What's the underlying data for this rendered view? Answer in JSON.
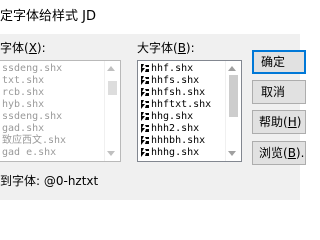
{
  "window": {
    "title": "定字体给样式 JD"
  },
  "small_font": {
    "label_prefix": "字体(",
    "label_key": "X",
    "label_suffix": "):",
    "items": [
      "ssdeng.shx",
      "txt.shx",
      "rcb.shx",
      "hyb.shx",
      "ssdeng.shx",
      "gad.shx",
      "致应西文.shx",
      "gad e.shx"
    ]
  },
  "big_font": {
    "label_prefix": "大字体(",
    "label_key": "B",
    "label_suffix": "):",
    "items": [
      "hhf.shx",
      "hhfs.shx",
      "hhfsh.shx",
      "hhftxt.shx",
      "hhg.shx",
      "hhh2.shx",
      "hhhbh.shx",
      "hhhg.shx"
    ]
  },
  "buttons": {
    "ok_label": "确定",
    "cancel_label": "取消",
    "help_prefix": "帮助(",
    "help_key": "H",
    "help_suffix": ")",
    "browse_prefix": "浏览(",
    "browse_key": "B",
    "browse_suffix": ")..."
  },
  "footer": {
    "text": "到字体: @0-hztxt"
  },
  "colors": {
    "dialog_bg": "#f0f0f0",
    "accent_focus": "#0078d7",
    "button_face": "#e1e1e1",
    "disabled_text": "#9a9a9a"
  },
  "icons": {
    "shx_item": "shx-font-icon"
  }
}
